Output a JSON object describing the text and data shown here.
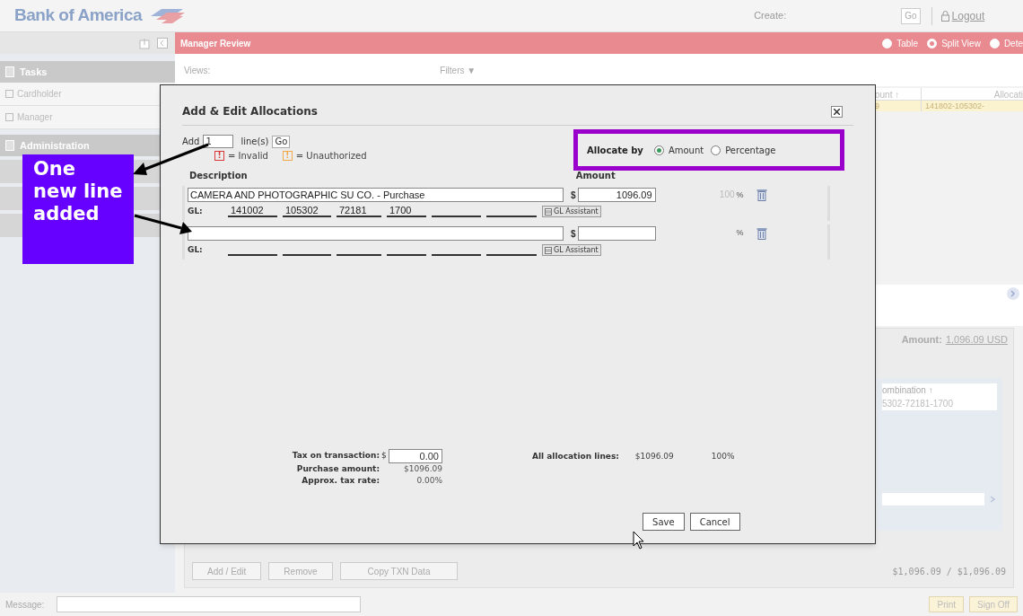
{
  "header": {
    "logo": "Bank of America",
    "create_label": "Create:",
    "go_button": "Go",
    "logout": "Logout"
  },
  "title_bar": {
    "title": "Manager Review",
    "view_options": [
      {
        "label": "Table",
        "selected": false
      },
      {
        "label": "Split View",
        "selected": true
      },
      {
        "label": "Dete",
        "selected": false
      }
    ]
  },
  "sidebar": {
    "sections": [
      {
        "title": "Tasks",
        "items": [
          {
            "label": "Cardholder"
          },
          {
            "label": "Manager"
          }
        ]
      },
      {
        "title": "Administration"
      }
    ]
  },
  "main": {
    "views_label": "Views:",
    "filters_label": "Filters ▼",
    "table": {
      "columns": [
        "ount ↑",
        "Allocati"
      ],
      "rows": [
        [
          "9",
          "141802-105302-"
        ]
      ]
    },
    "amount_label": "Amount:",
    "amount_link": "1,096.09 USD",
    "sub_table": {
      "columns": [
        "ombination ↑"
      ],
      "rows": [
        [
          "5302-72181-1700"
        ]
      ]
    },
    "totals": "$1,096.09 / $1,096.09",
    "buttons": [
      "Add / Edit",
      "Remove",
      "Copy TXN Data"
    ]
  },
  "footer": {
    "message_label": "Message:",
    "buttons": [
      "Print",
      "Sign Off"
    ]
  },
  "dialog": {
    "title": "Add & Edit Allocations",
    "add_label": "Add",
    "add_count": "1",
    "lines_label": "line(s)",
    "go_button": "Go",
    "legend": [
      {
        "mark": "!",
        "text": "= Invalid",
        "color": "#d9383a"
      },
      {
        "mark": "!",
        "text": "= Unauthorized",
        "color": "#f2a94a"
      }
    ],
    "allocate_by": {
      "label": "Allocate by",
      "options": [
        {
          "label": "Amount",
          "selected": true
        },
        {
          "label": "Percentage",
          "selected": false
        }
      ]
    },
    "description_header": "Description",
    "amount_header": "Amount",
    "lines": [
      {
        "description": "CAMERA AND PHOTOGRAPHIC SU CO. - Purchase",
        "currency": "$",
        "amount": "1096.09",
        "percent": "100",
        "percent_sign": "%",
        "gl_label": "GL:",
        "gl": [
          "141002",
          "105302",
          "72181",
          "1700"
        ],
        "gl_button": "GL Assistant"
      },
      {
        "currency": "$",
        "percent_sign": "%",
        "gl_label": "GL:",
        "gl_button": "GL Assistant"
      }
    ],
    "tax_label": "Tax on transaction:",
    "tax_currency": "$",
    "tax_value": "0.00",
    "purchase_label": "Purchase amount:",
    "purchase_value": "$1096.09",
    "rate_label": "Approx. tax rate:",
    "rate_value": "0.00%",
    "all_lines_label": "All allocation lines:",
    "all_lines_amount": "$1096.09",
    "all_lines_percent": "100%",
    "buttons": [
      "Save",
      "Cancel"
    ]
  },
  "annotation": {
    "text": "One new line added"
  }
}
